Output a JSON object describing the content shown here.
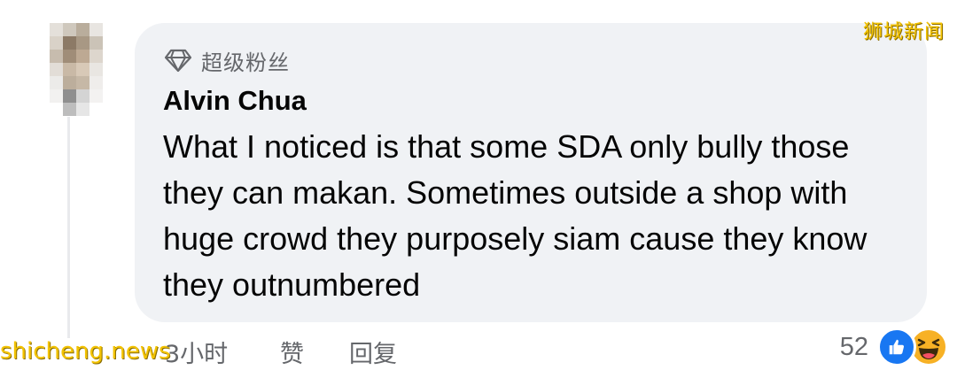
{
  "comment": {
    "badge_label": "超级粉丝",
    "author": "Alvin Chua",
    "text": "What I noticed is that some SDA only bully those they can makan. Sometimes outside a shop with huge crowd they purposely siam cause they know they outnumbered",
    "time": "3小时",
    "like_label": "赞",
    "reply_label": "回复",
    "reaction_count": "52",
    "reactions": [
      "like-icon",
      "haha-icon"
    ]
  },
  "watermarks": {
    "top_right": "狮城新闻",
    "bottom_left": "shicheng.news"
  },
  "colors": {
    "bubble_bg": "#f0f2f5",
    "secondary_text": "#65676b",
    "like_blue": "#1877f2",
    "haha_yellow": "#f7b125",
    "watermark_yellow": "#f3c300"
  }
}
